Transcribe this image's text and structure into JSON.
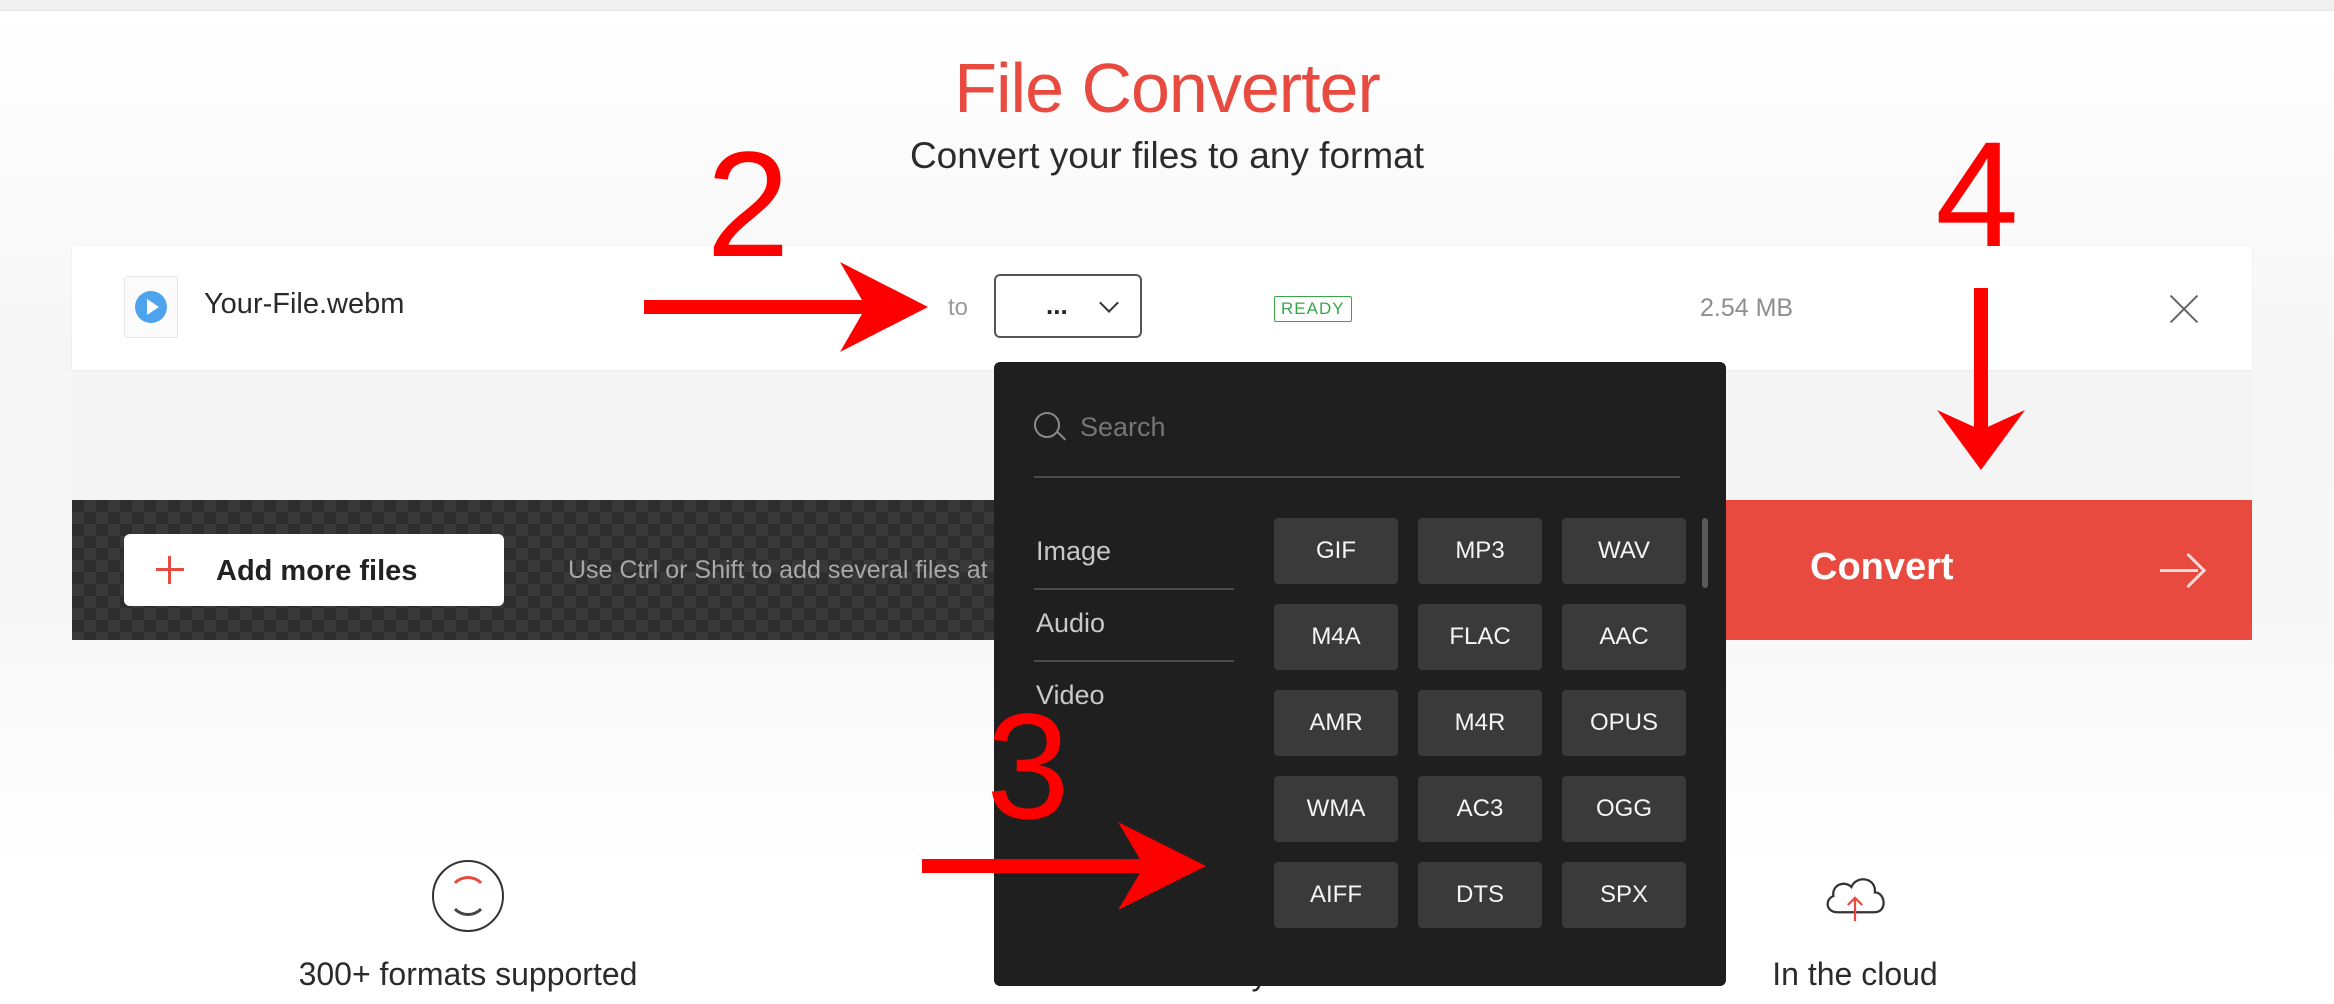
{
  "header": {
    "title": "File Converter",
    "subtitle": "Convert your files to any format"
  },
  "file": {
    "name": "Your-File.webm",
    "to_label": "to",
    "selected_format": "...",
    "status": "READY",
    "size": "2.54 MB"
  },
  "actions": {
    "add_more_label": "Add more files",
    "hint": "Use Ctrl or Shift to add several files at once",
    "convert_label": "Convert"
  },
  "dropdown": {
    "search_placeholder": "Search",
    "categories": [
      "Image",
      "Audio",
      "Video"
    ],
    "formats": [
      "GIF",
      "MP3",
      "WAV",
      "M4A",
      "FLAC",
      "AAC",
      "AMR",
      "M4R",
      "OPUS",
      "WMA",
      "AC3",
      "OGG",
      "AIFF",
      "DTS",
      "SPX"
    ]
  },
  "features": [
    "300+ formats supported",
    "Fast and easy",
    "In the cloud"
  ],
  "annotations": {
    "step2": "2",
    "step3": "3",
    "step4": "4",
    "color": "#ff0000"
  },
  "colors": {
    "accent": "#e84a3f",
    "ready": "#3aa64b",
    "dropdown_bg": "#1f1f1f"
  }
}
